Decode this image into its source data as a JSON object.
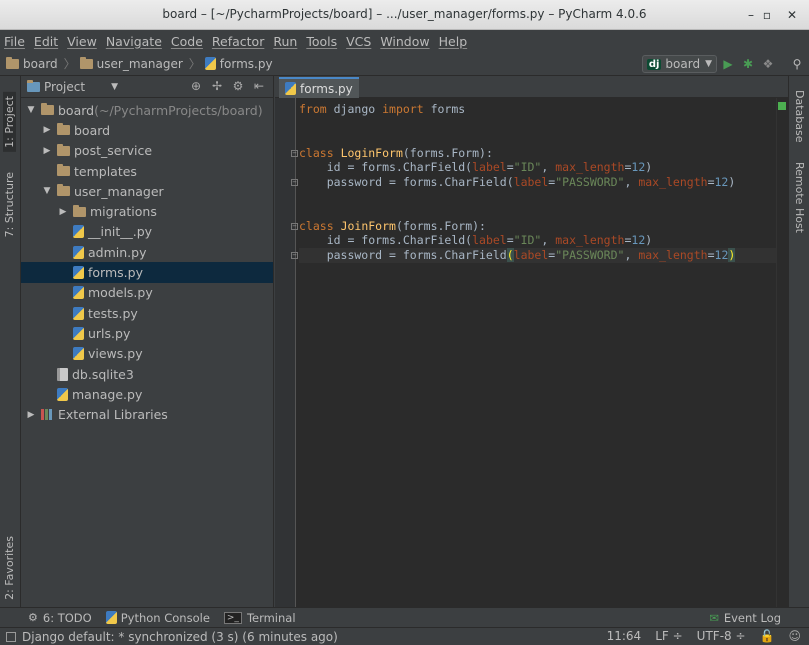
{
  "window": {
    "title": "board – [~/PycharmProjects/board] – .../user_manager/forms.py – PyCharm 4.0.6",
    "minimize": "–",
    "maximize": "▫",
    "close": "✕"
  },
  "menu": [
    "File",
    "Edit",
    "View",
    "Navigate",
    "Code",
    "Refactor",
    "Run",
    "Tools",
    "VCS",
    "Window",
    "Help"
  ],
  "breadcrumb": [
    "board",
    "user_manager",
    "forms.py"
  ],
  "toolbar": {
    "run_config": "board",
    "run_config_badge": "dj"
  },
  "left_strip": {
    "project_tab": "1: Project",
    "structure_tab": "7: Structure",
    "favorites_tab": "2: Favorites"
  },
  "right_strip": {
    "database_tab": "Database",
    "remote_host_tab": "Remote Host"
  },
  "project_panel": {
    "view_selector": "Project",
    "tree": [
      {
        "label": "board",
        "suffix": " (~/PycharmProjects/board)",
        "type": "folder",
        "level": 0,
        "arrow": "▼"
      },
      {
        "label": "board",
        "type": "folder",
        "level": 1,
        "arrow": "▶"
      },
      {
        "label": "post_service",
        "type": "folder",
        "level": 1,
        "arrow": "▶"
      },
      {
        "label": "templates",
        "type": "folder",
        "level": 1,
        "arrow": ""
      },
      {
        "label": "user_manager",
        "type": "folder",
        "level": 1,
        "arrow": "▼"
      },
      {
        "label": "migrations",
        "type": "folder",
        "level": 2,
        "arrow": "▶"
      },
      {
        "label": "__init__.py",
        "type": "py",
        "level": 2,
        "arrow": ""
      },
      {
        "label": "admin.py",
        "type": "py",
        "level": 2,
        "arrow": ""
      },
      {
        "label": "forms.py",
        "type": "py",
        "level": 2,
        "arrow": "",
        "selected": true
      },
      {
        "label": "models.py",
        "type": "py",
        "level": 2,
        "arrow": ""
      },
      {
        "label": "tests.py",
        "type": "py",
        "level": 2,
        "arrow": ""
      },
      {
        "label": "urls.py",
        "type": "py",
        "level": 2,
        "arrow": ""
      },
      {
        "label": "views.py",
        "type": "py",
        "level": 2,
        "arrow": ""
      },
      {
        "label": "db.sqlite3",
        "type": "db",
        "level": 1,
        "arrow": ""
      },
      {
        "label": "manage.py",
        "type": "py",
        "level": 1,
        "arrow": ""
      },
      {
        "label": "External Libraries",
        "type": "lib",
        "level": 0,
        "arrow": "▶"
      }
    ]
  },
  "editor": {
    "tab": "forms.py",
    "code": [
      [
        {
          "t": "from",
          "c": "kw"
        },
        {
          "t": " django "
        },
        {
          "t": "import",
          "c": "kw"
        },
        {
          "t": " forms"
        }
      ],
      [],
      [],
      [
        {
          "t": "class",
          "c": "kw"
        },
        {
          "t": " "
        },
        {
          "t": "LoginForm",
          "c": "cls"
        },
        {
          "t": "(forms.Form):"
        }
      ],
      [
        {
          "t": "    id = forms.CharField("
        },
        {
          "t": "label",
          "c": "param"
        },
        {
          "t": "="
        },
        {
          "t": "\"ID\"",
          "c": "str"
        },
        {
          "t": ", "
        },
        {
          "t": "max_length",
          "c": "param"
        },
        {
          "t": "="
        },
        {
          "t": "12",
          "c": "num"
        },
        {
          "t": ")"
        }
      ],
      [
        {
          "t": "    password = forms.CharField("
        },
        {
          "t": "label",
          "c": "param"
        },
        {
          "t": "="
        },
        {
          "t": "\"PASSWORD\"",
          "c": "str"
        },
        {
          "t": ", "
        },
        {
          "t": "max_length",
          "c": "param"
        },
        {
          "t": "="
        },
        {
          "t": "12",
          "c": "num"
        },
        {
          "t": ")"
        }
      ],
      [],
      [],
      [
        {
          "t": "class",
          "c": "kw"
        },
        {
          "t": " "
        },
        {
          "t": "JoinForm",
          "c": "cls"
        },
        {
          "t": "(forms.Form):"
        }
      ],
      [
        {
          "t": "    id = forms.CharField("
        },
        {
          "t": "label",
          "c": "param"
        },
        {
          "t": "="
        },
        {
          "t": "\"ID\"",
          "c": "str"
        },
        {
          "t": ", "
        },
        {
          "t": "max_length",
          "c": "param"
        },
        {
          "t": "="
        },
        {
          "t": "12",
          "c": "num"
        },
        {
          "t": ")"
        }
      ],
      [
        {
          "t": "    password = forms.CharField"
        },
        {
          "t": "(",
          "c": "brace"
        },
        {
          "t": "label",
          "c": "param"
        },
        {
          "t": "="
        },
        {
          "t": "\"PASSWORD\"",
          "c": "str"
        },
        {
          "t": ", "
        },
        {
          "t": "max_length",
          "c": "param"
        },
        {
          "t": "="
        },
        {
          "t": "12",
          "c": "num"
        },
        {
          "t": ")",
          "c": "brace"
        }
      ]
    ],
    "current_line": 10,
    "fold_lines": [
      3,
      5,
      8,
      10
    ]
  },
  "bottom_tabs": {
    "todo": "6: TODO",
    "python_console": "Python Console",
    "terminal": "Terminal",
    "event_log": "Event Log"
  },
  "status": {
    "message": "Django default: * synchronized (3 s) (6 minutes ago)",
    "position": "11:64",
    "line_separator": "LF ÷",
    "encoding": "UTF-8 ÷"
  },
  "colors": {
    "keyword": "#cc7832",
    "class_name": "#ffc66d",
    "string": "#6a8759",
    "number": "#6897bb",
    "param": "#aa4926",
    "selection": "#0d293e"
  }
}
